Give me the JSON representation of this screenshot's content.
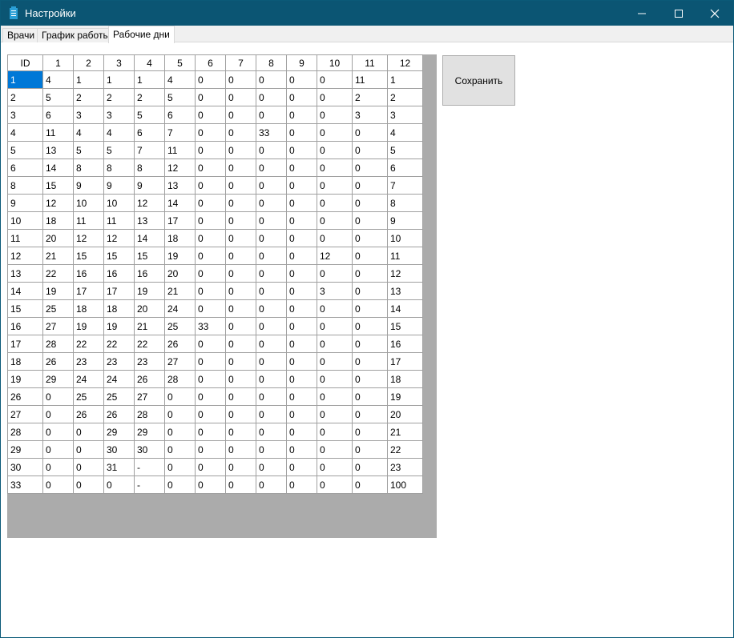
{
  "window": {
    "title": "Настройки"
  },
  "tabs": [
    {
      "label": "Врачи"
    },
    {
      "label": "График работы"
    },
    {
      "label": "Рабочие дни"
    }
  ],
  "save_button": {
    "label": "Сохранить"
  },
  "table": {
    "headers": [
      "ID",
      "1",
      "2",
      "3",
      "4",
      "5",
      "6",
      "7",
      "8",
      "9",
      "10",
      "11",
      "12"
    ],
    "rows": [
      [
        "1",
        "4",
        "1",
        "1",
        "1",
        "4",
        "0",
        "0",
        "0",
        "0",
        "0",
        "11",
        "1"
      ],
      [
        "2",
        "5",
        "2",
        "2",
        "2",
        "5",
        "0",
        "0",
        "0",
        "0",
        "0",
        "2",
        "2"
      ],
      [
        "3",
        "6",
        "3",
        "3",
        "5",
        "6",
        "0",
        "0",
        "0",
        "0",
        "0",
        "3",
        "3"
      ],
      [
        "4",
        "11",
        "4",
        "4",
        "6",
        "7",
        "0",
        "0",
        "33",
        "0",
        "0",
        "0",
        "4"
      ],
      [
        "5",
        "13",
        "5",
        "5",
        "7",
        "11",
        "0",
        "0",
        "0",
        "0",
        "0",
        "0",
        "5"
      ],
      [
        "6",
        "14",
        "8",
        "8",
        "8",
        "12",
        "0",
        "0",
        "0",
        "0",
        "0",
        "0",
        "6"
      ],
      [
        "8",
        "15",
        "9",
        "9",
        "9",
        "13",
        "0",
        "0",
        "0",
        "0",
        "0",
        "0",
        "7"
      ],
      [
        "9",
        "12",
        "10",
        "10",
        "12",
        "14",
        "0",
        "0",
        "0",
        "0",
        "0",
        "0",
        "8"
      ],
      [
        "10",
        "18",
        "11",
        "11",
        "13",
        "17",
        "0",
        "0",
        "0",
        "0",
        "0",
        "0",
        "9"
      ],
      [
        "11",
        "20",
        "12",
        "12",
        "14",
        "18",
        "0",
        "0",
        "0",
        "0",
        "0",
        "0",
        "10"
      ],
      [
        "12",
        "21",
        "15",
        "15",
        "15",
        "19",
        "0",
        "0",
        "0",
        "0",
        "12",
        "0",
        "11"
      ],
      [
        "13",
        "22",
        "16",
        "16",
        "16",
        "20",
        "0",
        "0",
        "0",
        "0",
        "0",
        "0",
        "12"
      ],
      [
        "14",
        "19",
        "17",
        "17",
        "19",
        "21",
        "0",
        "0",
        "0",
        "0",
        "3",
        "0",
        "13"
      ],
      [
        "15",
        "25",
        "18",
        "18",
        "20",
        "24",
        "0",
        "0",
        "0",
        "0",
        "0",
        "0",
        "14"
      ],
      [
        "16",
        "27",
        "19",
        "19",
        "21",
        "25",
        "33",
        "0",
        "0",
        "0",
        "0",
        "0",
        "15"
      ],
      [
        "17",
        "28",
        "22",
        "22",
        "22",
        "26",
        "0",
        "0",
        "0",
        "0",
        "0",
        "0",
        "16"
      ],
      [
        "18",
        "26",
        "23",
        "23",
        "23",
        "27",
        "0",
        "0",
        "0",
        "0",
        "0",
        "0",
        "17"
      ],
      [
        "19",
        "29",
        "24",
        "24",
        "26",
        "28",
        "0",
        "0",
        "0",
        "0",
        "0",
        "0",
        "18"
      ],
      [
        "26",
        "0",
        "25",
        "25",
        "27",
        "0",
        "0",
        "0",
        "0",
        "0",
        "0",
        "0",
        "19"
      ],
      [
        "27",
        "0",
        "26",
        "26",
        "28",
        "0",
        "0",
        "0",
        "0",
        "0",
        "0",
        "0",
        "20"
      ],
      [
        "28",
        "0",
        "0",
        "29",
        "29",
        "0",
        "0",
        "0",
        "0",
        "0",
        "0",
        "0",
        "21"
      ],
      [
        "29",
        "0",
        "0",
        "30",
        "30",
        "0",
        "0",
        "0",
        "0",
        "0",
        "0",
        "0",
        "22"
      ],
      [
        "30",
        "0",
        "0",
        "31",
        "-",
        "0",
        "0",
        "0",
        "0",
        "0",
        "0",
        "0",
        "23"
      ],
      [
        "33",
        "0",
        "0",
        "0",
        "-",
        "0",
        "0",
        "0",
        "0",
        "0",
        "0",
        "0",
        "100"
      ]
    ],
    "selected_cell": {
      "row": 0,
      "col": 0
    }
  },
  "icons": {
    "app": "app-icon",
    "minimize": "minimize-icon",
    "maximize": "maximize-icon",
    "close": "close-icon"
  },
  "colors": {
    "titlebar": "#0b5573",
    "selection": "#0078d7",
    "grid_background": "#ababab",
    "button_face": "#e1e1e1"
  }
}
